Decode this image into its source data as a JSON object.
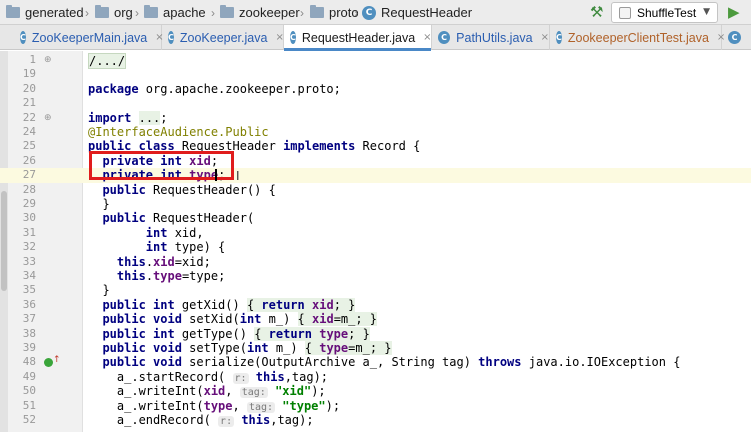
{
  "breadcrumb": {
    "items": [
      "generated",
      "org",
      "apache",
      "zookeeper",
      "proto",
      "RequestHeader"
    ],
    "class_badge": "C"
  },
  "toolbar": {
    "run_config": "ShuffleTest",
    "build_icon": "hammer-icon",
    "run_icon": "play-icon",
    "caret": "▼"
  },
  "tabs": [
    {
      "label": "ZooKeeperMain.java",
      "badge": "C",
      "close": "×"
    },
    {
      "label": "ZooKeeper.java",
      "badge": "C",
      "close": "×"
    },
    {
      "label": "RequestHeader.java",
      "badge": "C",
      "close": "×"
    },
    {
      "label": "PathUtils.java",
      "badge": "C",
      "close": "×"
    },
    {
      "label": "ZookeeperClientTest.java",
      "badge": "C",
      "close": "×"
    },
    {
      "label": "",
      "badge": "C",
      "close": ""
    }
  ],
  "editor": {
    "lines": [
      {
        "no": "1",
        "code": "/.../"
      },
      {
        "no": "19",
        "code": ""
      },
      {
        "no": "20",
        "code": "package org.apache.zookeeper.proto;"
      },
      {
        "no": "21",
        "code": ""
      },
      {
        "no": "22",
        "code": "import ...;"
      },
      {
        "no": "24",
        "code": "@InterfaceAudience.Public"
      },
      {
        "no": "25",
        "code": "public class RequestHeader implements Record {"
      },
      {
        "no": "26",
        "code": "  private int xid;"
      },
      {
        "no": "27",
        "code": "  private int type;"
      },
      {
        "no": "28",
        "code": "  public RequestHeader() {"
      },
      {
        "no": "29",
        "code": "  }"
      },
      {
        "no": "30",
        "code": "  public RequestHeader("
      },
      {
        "no": "31",
        "code": "        int xid,"
      },
      {
        "no": "32",
        "code": "        int type) {"
      },
      {
        "no": "33",
        "code": "    this.xid=xid;"
      },
      {
        "no": "34",
        "code": "    this.type=type;"
      },
      {
        "no": "35",
        "code": "  }"
      },
      {
        "no": "36",
        "code": "  public int getXid() { return xid; }"
      },
      {
        "no": "37",
        "code": "  public void setXid(int m_) { xid=m_; }"
      },
      {
        "no": "38",
        "code": "  public int getType() { return type; }"
      },
      {
        "no": "39",
        "code": "  public void setType(int m_) { type=m_; }"
      },
      {
        "no": "48",
        "code": "  public void serialize(OutputArchive a_, String tag) throws java.io.IOException {"
      },
      {
        "no": "49",
        "code": "    a_.startRecord( r: this,tag);"
      },
      {
        "no": "50",
        "code": "    a_.writeInt(xid, tag: \"xid\");"
      },
      {
        "no": "51",
        "code": "    a_.writeInt(type, tag: \"type\");"
      },
      {
        "no": "52",
        "code": "    a_.endRecord( r: this,tag);"
      }
    ],
    "current_line": "27",
    "override_icon": "override-implements-icon",
    "highlight_color": "#e01c1c"
  }
}
